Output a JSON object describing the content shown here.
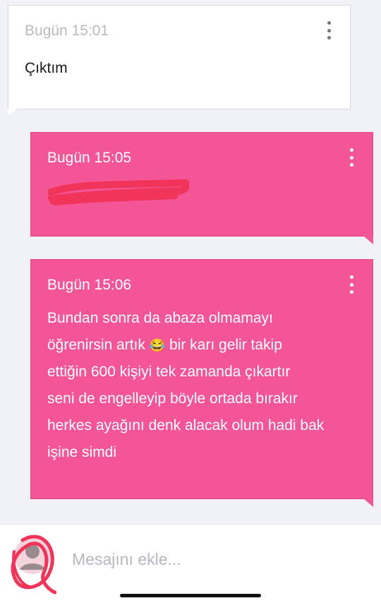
{
  "messages": [
    {
      "direction": "incoming",
      "time": "Bugün 15:01",
      "text": "Çıktım"
    },
    {
      "direction": "outgoing",
      "time": "Bugün 15:05",
      "text": ""
    },
    {
      "direction": "outgoing",
      "time": "Bugün 15:06",
      "lines": [
        "Bundan sonra da abaza olmamayı",
        "öğrenirsin artık",
        "bir karı gelir takip",
        "ettiğin 600 kişiyi tek zamanda çıkartır",
        "seni de engelleyip böyle ortada bırakır",
        "herkes ayağını denk alacak olum hadi bak",
        "işine simdi"
      ],
      "emoji": "😂"
    }
  ],
  "composer": {
    "placeholder": "Mesajını ekle..."
  },
  "icons": {
    "more": "more-vertical-icon",
    "avatar": "avatar"
  },
  "colors": {
    "background": "#f1f1f8",
    "outgoing_bubble": "#f45596",
    "incoming_bubble": "#ffffff",
    "redaction": "#f0345a"
  }
}
